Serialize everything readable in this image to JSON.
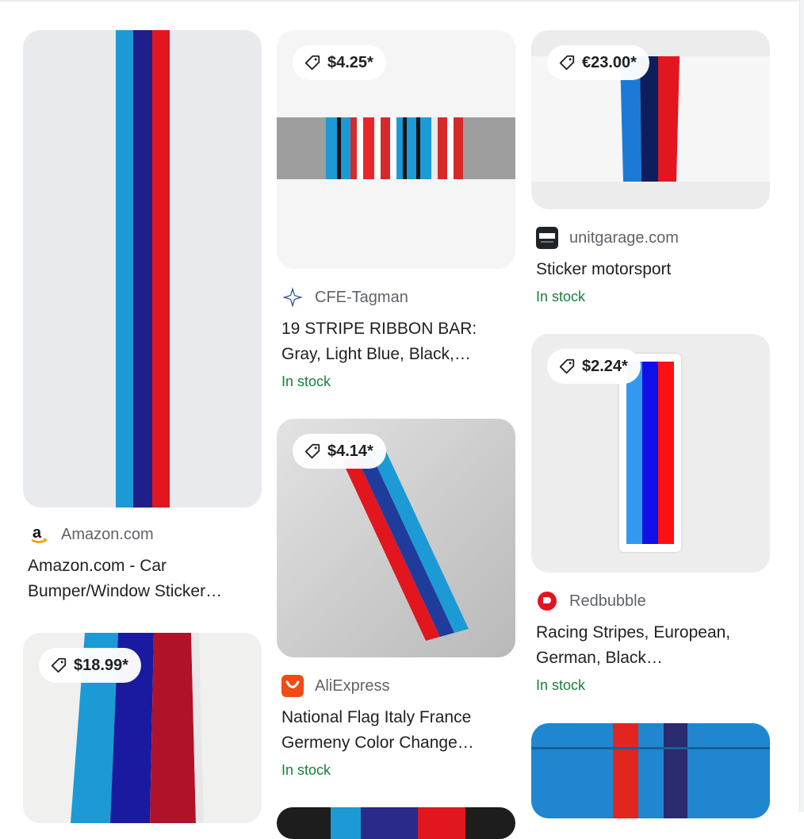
{
  "colors": {
    "light_blue": "#1c9ad6",
    "dark_blue": "#1f1f8c",
    "red": "#e2161f",
    "in_stock_green": "#188038",
    "muted_text": "#5f6368"
  },
  "results": [
    {
      "source": "Amazon.com",
      "icon": "amazon-logo-icon",
      "title": "Amazon.com - Car Bumper/Window Sticker…",
      "price": "",
      "stock": ""
    },
    {
      "price": "$18.99*",
      "source": "",
      "title": "",
      "stock": ""
    },
    {
      "price": "$4.25*",
      "source": "CFE-Tagman",
      "icon": "star-logo-icon",
      "title": "19 STRIPE RIBBON BAR: Gray, Light Blue, Black,…",
      "stock": "In stock"
    },
    {
      "price": "$4.14*",
      "source": "AliExpress",
      "icon": "aliexpress-logo-icon",
      "title": "National Flag Italy France Germeny Color Change…",
      "stock": "In stock"
    },
    {
      "price": "€23.00*",
      "source": "unitgarage.com",
      "icon": "unit-logo-icon",
      "title": "Sticker motorsport",
      "stock": "In stock"
    },
    {
      "price": "$2.24*",
      "source": "Redbubble",
      "icon": "redbubble-logo-icon",
      "title": "Racing Stripes, European, German, Black…",
      "stock": "In stock"
    },
    {
      "price": "",
      "source": "",
      "title": "",
      "stock": ""
    }
  ]
}
